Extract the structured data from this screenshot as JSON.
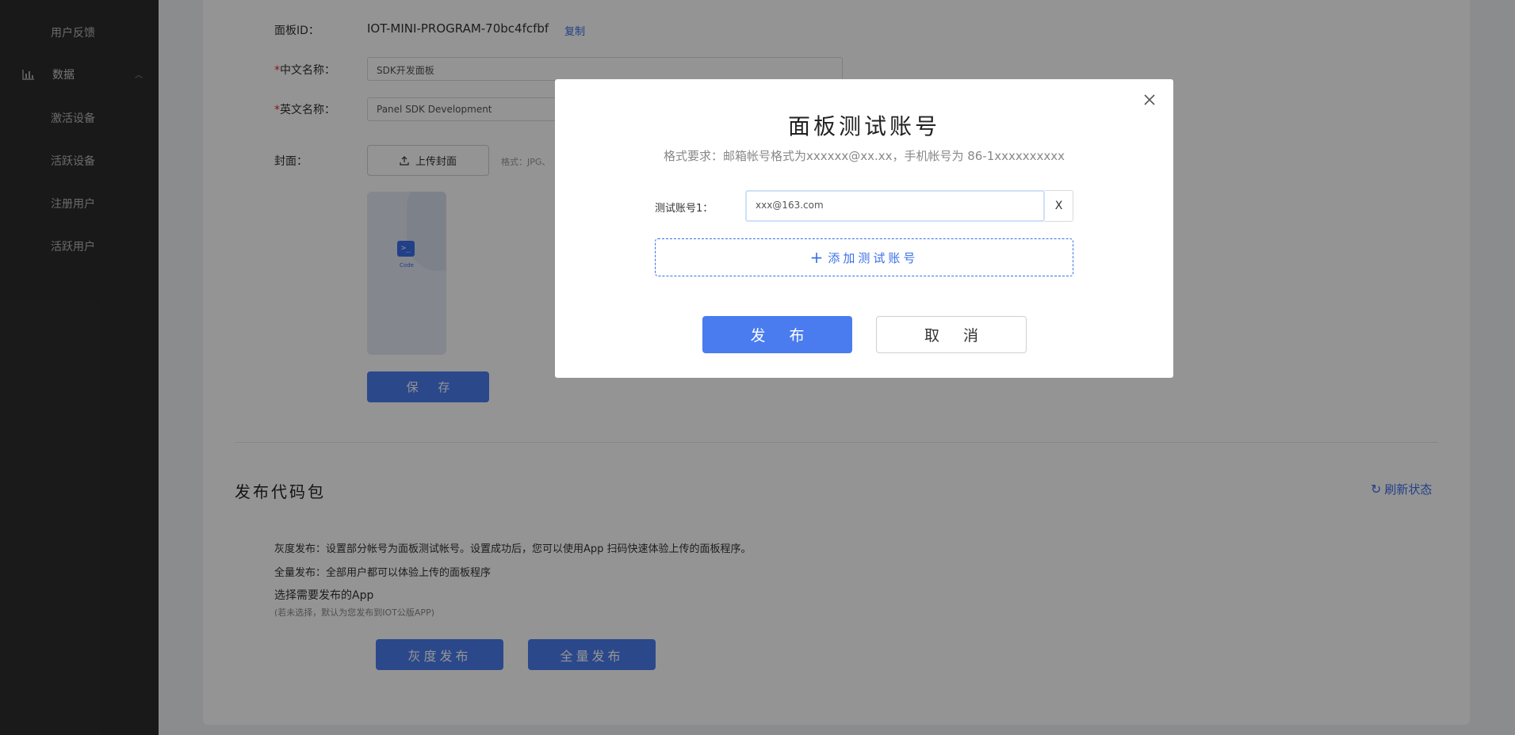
{
  "sidebar": {
    "items": [
      {
        "label": "用户反馈"
      },
      {
        "label": "数据"
      },
      {
        "label": "激活设备"
      },
      {
        "label": "活跃设备"
      },
      {
        "label": "注册用户"
      },
      {
        "label": "活跃用户"
      }
    ]
  },
  "form": {
    "panel_id_label": "面板ID：",
    "panel_id_value": "IOT-MINI-PROGRAM-70bc4fcfbf",
    "copy_label": "复制",
    "required_mark": "*",
    "cn_name_label": "中文名称：",
    "cn_name_value": "SDK开发面板",
    "en_name_label": "英文名称：",
    "en_name_value": "Panel SDK Development",
    "cover_label": "封面：",
    "upload_label": "上传封面",
    "format_hint": "格式：JPG、",
    "cover_code_label": "Code",
    "cover_code_glyph": ">_",
    "save_label": "保 存"
  },
  "publish_section": {
    "title": "发布代码包",
    "refresh_label": "刷新状态",
    "gray_desc": "灰度发布：设置部分帐号为面板测试帐号。设置成功后，您可以使用App 扫码快速体验上传的面板程序。",
    "full_desc": "全量发布：全部用户都可以体验上传的面板程序",
    "select_app_label": "选择需要发布的App",
    "select_app_note": "(若未选择，默认为您发布到IOT公版APP)",
    "gray_button": "灰度发布",
    "full_button": "全量发布"
  },
  "modal": {
    "title": "面板测试账号",
    "hint": "格式要求：邮箱帐号格式为xxxxxx@xx.xx，手机帐号为 86-1xxxxxxxxxx",
    "account_label": "测试账号1：",
    "account_value": "xxx@163.com",
    "remove_label": "X",
    "add_label": "添加测试账号",
    "add_plus": "+",
    "publish_label": "发 布",
    "cancel_label": "取 消"
  },
  "colors": {
    "accent": "#4a7cf0",
    "link": "#3a6fe8",
    "sidebar_bg": "#2c2c2c",
    "required": "#f5222d"
  }
}
